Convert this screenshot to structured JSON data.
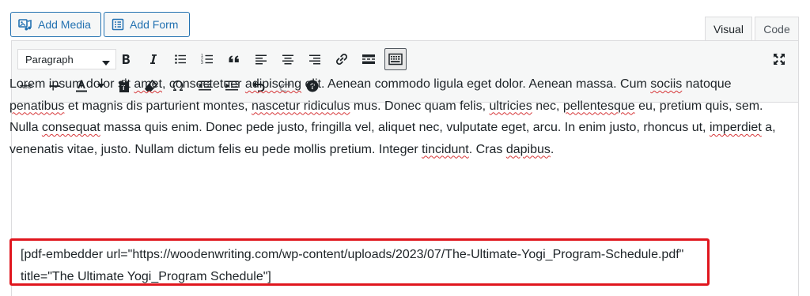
{
  "media_buttons": {
    "add_media": "Add Media",
    "add_form": "Add Form"
  },
  "tabs": {
    "visual": "Visual",
    "code": "Code"
  },
  "toolbar": {
    "format_select": "Paragraph",
    "row1_icons": [
      "bold-icon",
      "italic-icon",
      "bulleted-list-icon",
      "numbered-list-icon",
      "blockquote-icon",
      "align-left-icon",
      "align-center-icon",
      "align-right-icon",
      "link-icon",
      "read-more-icon",
      "toolbar-toggle-icon"
    ],
    "row2_icons": [
      "strikethrough-icon",
      "horizontal-line-icon",
      "text-color-icon",
      "paste-text-icon",
      "clear-formatting-icon",
      "special-character-icon",
      "outdent-icon",
      "indent-icon",
      "undo-icon",
      "redo-icon",
      "keyboard-shortcuts-icon"
    ],
    "fullscreen_icon": "fullscreen-icon"
  },
  "content": {
    "paragraph": [
      {
        "t": "Lorem ipsum dolor sit "
      },
      {
        "t": "amet",
        "s": true
      },
      {
        "t": ", consectetuer "
      },
      {
        "t": "adipiscing",
        "s": true
      },
      {
        "t": " elit. Aenean commodo ligula eget dolor. Aenean massa. Cum "
      },
      {
        "t": "sociis",
        "s": true
      },
      {
        "t": " natoque "
      },
      {
        "t": "penatibus",
        "s": true
      },
      {
        "t": " et magnis dis parturient montes, "
      },
      {
        "t": "nascetur ridiculus",
        "s": true
      },
      {
        "t": " mus. Donec quam felis, "
      },
      {
        "t": "ultricies",
        "s": true
      },
      {
        "t": " nec, "
      },
      {
        "t": "pellentesque",
        "s": true
      },
      {
        "t": " eu, pretium quis, sem. Nulla "
      },
      {
        "t": "consequat",
        "s": true
      },
      {
        "t": " massa quis enim. Donec pede justo, fringilla vel, aliquet nec, vulputate eget, arcu. In enim justo, rhoncus ut, "
      },
      {
        "t": "imperdiet",
        "s": true
      },
      {
        "t": " a, venenatis vitae, justo. Nullam dictum felis eu pede mollis pretium. Integer "
      },
      {
        "t": "tincidunt",
        "s": true
      },
      {
        "t": ". Cras "
      },
      {
        "t": "dapibus",
        "s": true
      },
      {
        "t": "."
      }
    ],
    "shortcode": "[pdf-embedder url=\"https://woodenwriting.com/wp-content/uploads/2023/07/The-Ultimate-Yogi_Program-Schedule.pdf\" title=\"The Ultimate Yogi_Program Schedule\"]"
  },
  "colors": {
    "accent": "#2271b1",
    "highlight_border": "#e0161e",
    "spellcheck": "#d63638"
  }
}
